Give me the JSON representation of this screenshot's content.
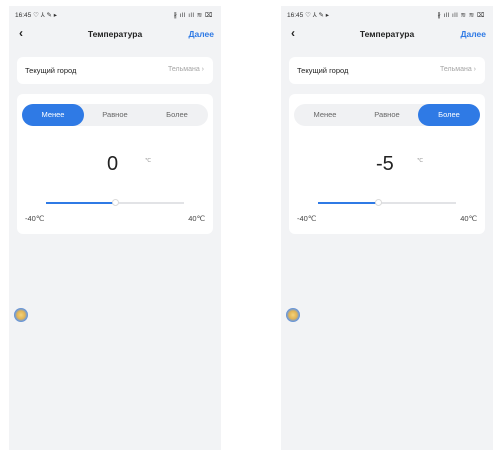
{
  "screens": [
    {
      "status": {
        "time": "16:45 ♡ ⅄ ✎ ▸",
        "icons": "∦ ıll ıll ≋ ⌧"
      },
      "nav": {
        "back_icon": "‹",
        "title": "Температура",
        "next": "Далее"
      },
      "city": {
        "label": "Текущий город",
        "value": "Тельмана ›"
      },
      "tabs": [
        "Менее",
        "Равное",
        "Более"
      ],
      "active_tab": 0,
      "value": "0",
      "unit": "℃",
      "slider": {
        "fraction": 0.5,
        "min_label": "-40℃",
        "max_label": "40℃"
      }
    },
    {
      "status": {
        "time": "16:45 ♡ ⅄ ✎ ▸",
        "icons": "∦ ıll ıll ≋ ≋ ⌧"
      },
      "nav": {
        "back_icon": "‹",
        "title": "Температура",
        "next": "Далее"
      },
      "city": {
        "label": "Текущий город",
        "value": "Тельмана ›"
      },
      "tabs": [
        "Менее",
        "Равное",
        "Более"
      ],
      "active_tab": 2,
      "value": "-5",
      "unit": "℃",
      "slider": {
        "fraction": 0.4375,
        "min_label": "-40℃",
        "max_label": "40℃"
      }
    }
  ],
  "colors": {
    "accent": "#2f7ae5",
    "background": "#f2f3f5",
    "card": "#ffffff",
    "track": "#e2e3e6"
  },
  "icons": {
    "back": "chevron-left-icon",
    "floating": "floating-assistant-icon"
  }
}
